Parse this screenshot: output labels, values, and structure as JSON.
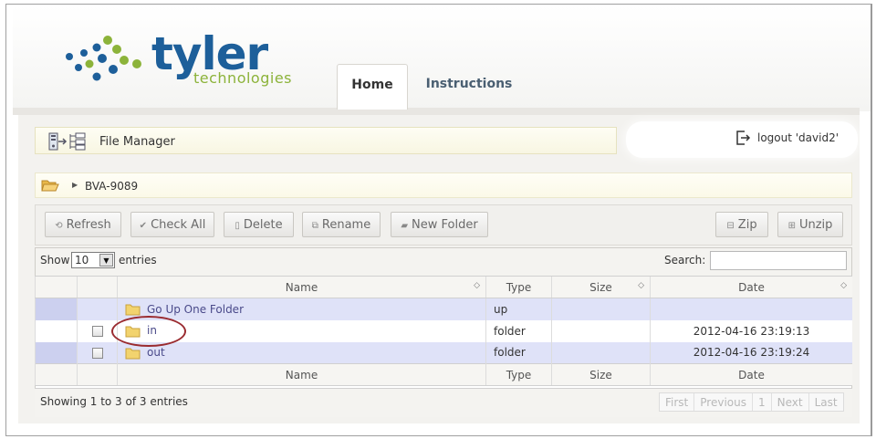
{
  "brand": {
    "name": "tyler",
    "subtitle": "technologies",
    "primary_color": "#1d5f9a",
    "accent_color": "#8cb33a"
  },
  "tabs": [
    {
      "label": "Home",
      "active": true
    },
    {
      "label": "Instructions",
      "active": false
    }
  ],
  "file_manager": {
    "title": "File Manager",
    "icon": "file-transfer-icon"
  },
  "user": {
    "logout_label": "logout 'david2'",
    "icon": "logout-icon"
  },
  "breadcrumb": {
    "icon": "open-folder-icon",
    "path": "BVA-9089"
  },
  "toolbar": {
    "refresh": "Refresh",
    "check_all": "Check All",
    "delete": "Delete",
    "rename": "Rename",
    "new_folder": "New Folder",
    "zip": "Zip",
    "unzip": "Unzip"
  },
  "table_controls": {
    "show_label": "Show",
    "page_size": "10",
    "entries_label": "entries",
    "search_label": "Search:",
    "search_value": ""
  },
  "columns": {
    "name": "Name",
    "type": "Type",
    "size": "Size",
    "date": "Date"
  },
  "rows": [
    {
      "name": "Go Up One Folder",
      "type": "up",
      "size": "",
      "date": ""
    },
    {
      "name": "in",
      "type": "folder",
      "size": "",
      "date": "2012-04-16 23:19:13"
    },
    {
      "name": "out",
      "type": "folder",
      "size": "",
      "date": "2012-04-16 23:19:24"
    }
  ],
  "footer": {
    "info": "Showing 1 to 3 of 3 entries",
    "pager": {
      "first": "First",
      "previous": "Previous",
      "current": "1",
      "next": "Next",
      "last": "Last"
    }
  }
}
